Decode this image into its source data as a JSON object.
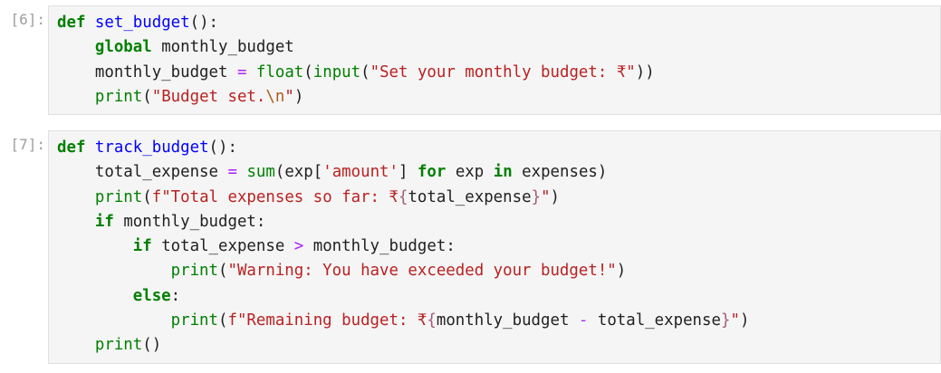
{
  "cells": [
    {
      "prompt": "[6]:",
      "lines": [
        [
          {
            "t": "kw",
            "v": "def"
          },
          {
            "t": "name",
            "v": " "
          },
          {
            "t": "def",
            "v": "set_budget"
          },
          {
            "t": "name",
            "v": "():"
          }
        ],
        [
          {
            "t": "name",
            "v": "    "
          },
          {
            "t": "kw",
            "v": "global"
          },
          {
            "t": "name",
            "v": " monthly_budget"
          }
        ],
        [
          {
            "t": "name",
            "v": "    monthly_budget "
          },
          {
            "t": "op",
            "v": "="
          },
          {
            "t": "name",
            "v": " "
          },
          {
            "t": "bi",
            "v": "float"
          },
          {
            "t": "name",
            "v": "("
          },
          {
            "t": "bi",
            "v": "input"
          },
          {
            "t": "name",
            "v": "("
          },
          {
            "t": "str",
            "v": "\"Set your monthly budget: ₹\""
          },
          {
            "t": "name",
            "v": "))"
          }
        ],
        [
          {
            "t": "name",
            "v": "    "
          },
          {
            "t": "bi",
            "v": "print"
          },
          {
            "t": "name",
            "v": "("
          },
          {
            "t": "str",
            "v": "\"Budget set."
          },
          {
            "t": "esc",
            "v": "\\n"
          },
          {
            "t": "str",
            "v": "\""
          },
          {
            "t": "name",
            "v": ")"
          }
        ]
      ]
    },
    {
      "prompt": "[7]:",
      "lines": [
        [
          {
            "t": "kw",
            "v": "def"
          },
          {
            "t": "name",
            "v": " "
          },
          {
            "t": "def",
            "v": "track_budget"
          },
          {
            "t": "name",
            "v": "():"
          }
        ],
        [
          {
            "t": "name",
            "v": "    total_expense "
          },
          {
            "t": "op",
            "v": "="
          },
          {
            "t": "name",
            "v": " "
          },
          {
            "t": "bi",
            "v": "sum"
          },
          {
            "t": "name",
            "v": "(exp["
          },
          {
            "t": "str",
            "v": "'amount'"
          },
          {
            "t": "name",
            "v": "] "
          },
          {
            "t": "kw",
            "v": "for"
          },
          {
            "t": "name",
            "v": " exp "
          },
          {
            "t": "kw",
            "v": "in"
          },
          {
            "t": "name",
            "v": " expenses)"
          }
        ],
        [
          {
            "t": "name",
            "v": "    "
          },
          {
            "t": "bi",
            "v": "print"
          },
          {
            "t": "name",
            "v": "("
          },
          {
            "t": "str",
            "v": "f\"Total expenses so far: ₹"
          },
          {
            "t": "interp",
            "v": "{"
          },
          {
            "t": "name",
            "v": "total_expense"
          },
          {
            "t": "interp",
            "v": "}"
          },
          {
            "t": "str",
            "v": "\""
          },
          {
            "t": "name",
            "v": ")"
          }
        ],
        [
          {
            "t": "name",
            "v": "    "
          },
          {
            "t": "kw",
            "v": "if"
          },
          {
            "t": "name",
            "v": " monthly_budget:"
          }
        ],
        [
          {
            "t": "name",
            "v": "        "
          },
          {
            "t": "kw",
            "v": "if"
          },
          {
            "t": "name",
            "v": " total_expense "
          },
          {
            "t": "op",
            "v": ">"
          },
          {
            "t": "name",
            "v": " monthly_budget:"
          }
        ],
        [
          {
            "t": "name",
            "v": "            "
          },
          {
            "t": "bi",
            "v": "print"
          },
          {
            "t": "name",
            "v": "("
          },
          {
            "t": "str",
            "v": "\"Warning: You have exceeded your budget!\""
          },
          {
            "t": "name",
            "v": ")"
          }
        ],
        [
          {
            "t": "name",
            "v": "        "
          },
          {
            "t": "kw",
            "v": "else"
          },
          {
            "t": "name",
            "v": ":"
          }
        ],
        [
          {
            "t": "name",
            "v": "            "
          },
          {
            "t": "bi",
            "v": "print"
          },
          {
            "t": "name",
            "v": "("
          },
          {
            "t": "str",
            "v": "f\"Remaining budget: ₹"
          },
          {
            "t": "interp",
            "v": "{"
          },
          {
            "t": "name",
            "v": "monthly_budget "
          },
          {
            "t": "op",
            "v": "-"
          },
          {
            "t": "name",
            "v": " total_expense"
          },
          {
            "t": "interp",
            "v": "}"
          },
          {
            "t": "str",
            "v": "\""
          },
          {
            "t": "name",
            "v": ")"
          }
        ],
        [
          {
            "t": "name",
            "v": "    "
          },
          {
            "t": "bi",
            "v": "print"
          },
          {
            "t": "name",
            "v": "()"
          }
        ]
      ]
    }
  ],
  "colors": {
    "keyword": "#008000",
    "function_name": "#0000ff",
    "string": "#ba2121",
    "operator": "#aa22ff",
    "cell_background": "#f5f5f5",
    "prompt": "#9e9e9e"
  }
}
